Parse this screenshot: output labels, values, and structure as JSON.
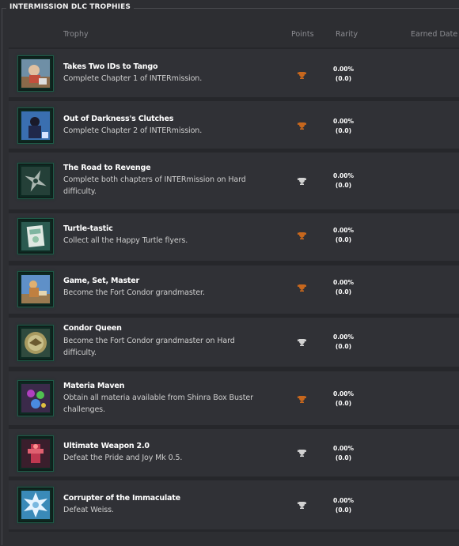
{
  "section": {
    "title": "INTERMISSION DLC TROPHIES"
  },
  "columns": {
    "trophy": "Trophy",
    "points": "Points",
    "rarity": "Rarity",
    "earned": "Earned Date"
  },
  "colors": {
    "bronze": "#c7671d",
    "silver": "#d2d2d2",
    "bg": "#2d2e32",
    "row": "#303136"
  },
  "trophies": [
    {
      "name": "Takes Two IDs to Tango",
      "description": "Complete Chapter 1 of INTERmission.",
      "grade": "bronze",
      "icon": "yuffie-chapter1-icon",
      "rarity_pct": "0.00%",
      "rarity_pts": "(0.0)",
      "earned": ""
    },
    {
      "name": "Out of Darkness's Clutches",
      "description": "Complete Chapter 2 of INTERmission.",
      "grade": "bronze",
      "icon": "yuffie-chapter2-icon",
      "rarity_pct": "0.00%",
      "rarity_pts": "(0.0)",
      "earned": ""
    },
    {
      "name": "The Road to Revenge",
      "description": "Complete both chapters of INTERmission on Hard difficulty.",
      "grade": "silver",
      "icon": "shuriken-icon",
      "rarity_pct": "0.00%",
      "rarity_pts": "(0.0)",
      "earned": ""
    },
    {
      "name": "Turtle-tastic",
      "description": "Collect all the Happy Turtle flyers.",
      "grade": "bronze",
      "icon": "turtle-flyer-icon",
      "rarity_pct": "0.00%",
      "rarity_pts": "(0.0)",
      "earned": ""
    },
    {
      "name": "Game, Set, Master",
      "description": "Become the Fort Condor grandmaster.",
      "grade": "bronze",
      "icon": "fort-condor-icon",
      "rarity_pct": "0.00%",
      "rarity_pts": "(0.0)",
      "earned": ""
    },
    {
      "name": "Condor Queen",
      "description": "Become the Fort Condor grandmaster on Hard difficulty.",
      "grade": "silver",
      "icon": "condor-medal-icon",
      "rarity_pct": "0.00%",
      "rarity_pts": "(0.0)",
      "earned": ""
    },
    {
      "name": "Materia Maven",
      "description": "Obtain all materia available from Shinra Box Buster challenges.",
      "grade": "bronze",
      "icon": "materia-icon",
      "rarity_pct": "0.00%",
      "rarity_pts": "(0.0)",
      "earned": ""
    },
    {
      "name": "Ultimate Weapon 2.0",
      "description": "Defeat the Pride and Joy Mk 0.5.",
      "grade": "silver",
      "icon": "pride-and-joy-icon",
      "rarity_pct": "0.00%",
      "rarity_pts": "(0.0)",
      "earned": ""
    },
    {
      "name": "Corrupter of the Immaculate",
      "description": "Defeat Weiss.",
      "grade": "silver",
      "icon": "weiss-icon",
      "rarity_pct": "0.00%",
      "rarity_pts": "(0.0)",
      "earned": ""
    }
  ]
}
